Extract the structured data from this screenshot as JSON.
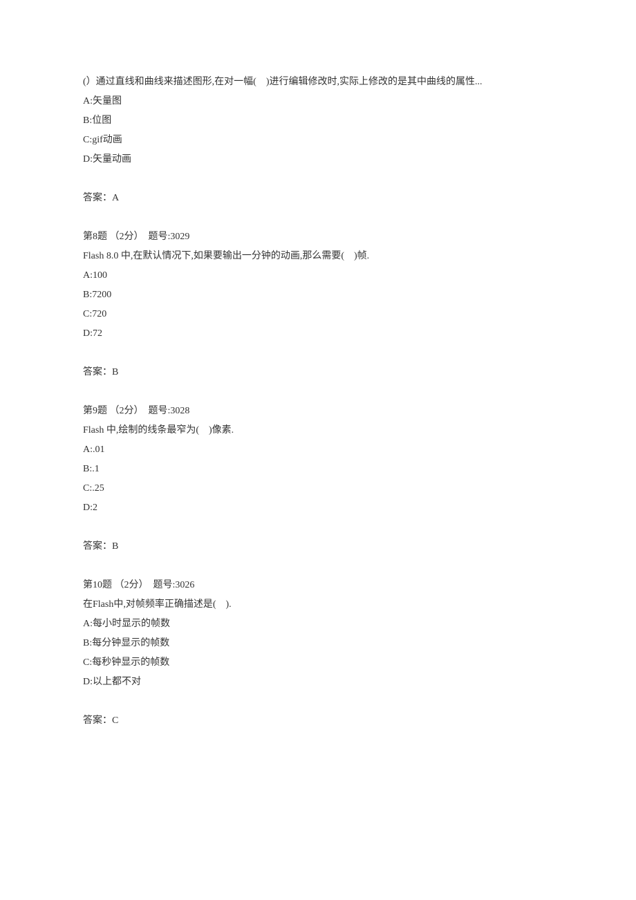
{
  "questions": [
    {
      "header": "",
      "prompt": "(）通过直线和曲线来描述图形,在对一幅(    )进行编辑修改时,实际上修改的是其中曲线的属性...",
      "options": [
        "A:矢量图",
        "B:位图",
        "C:gif动画",
        "D:矢量动画"
      ],
      "answer": "答案：A"
    },
    {
      "header": "第8题 （2分）  题号:3029",
      "prompt": "Flash 8.0 中,在默认情况下,如果要输出一分钟的动画,那么需要(    )帧.",
      "options": [
        "A:100",
        "B:7200",
        "C:720",
        "D:72"
      ],
      "answer": "答案：B"
    },
    {
      "header": "第9题 （2分）  题号:3028",
      "prompt": "Flash 中,绘制的线条最窄为(    )像素.",
      "options": [
        "A:.01",
        "B:.1",
        "C:.25",
        "D:2"
      ],
      "answer": "答案：B"
    },
    {
      "header": "第10题 （2分）  题号:3026",
      "prompt": "在Flash中,对帧频率正确描述是(    ).",
      "options": [
        "A:每小时显示的帧数",
        "B:每分钟显示的帧数",
        "C:每秒钟显示的帧数",
        "D:以上都不对"
      ],
      "answer": "答案：C"
    }
  ]
}
